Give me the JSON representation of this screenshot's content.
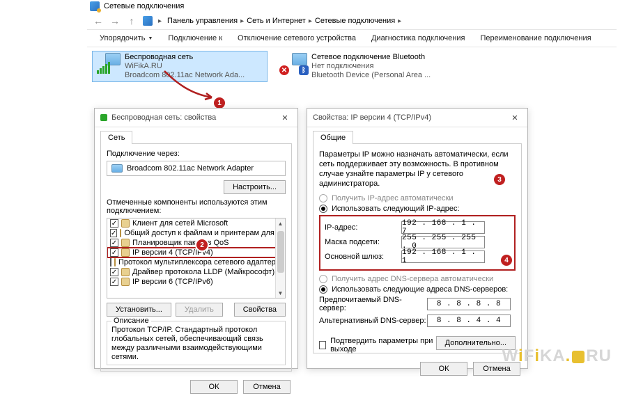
{
  "mainWindow": {
    "title": "Сетевые подключения",
    "breadcrumb": {
      "items": [
        "Панель управления",
        "Сеть и Интернет",
        "Сетевые подключения"
      ]
    },
    "toolbar": {
      "organize": "Упорядочить",
      "connect": "Подключение к",
      "disable": "Отключение сетевого устройства",
      "diagnose": "Диагностика подключения",
      "rename": "Переименование подключения"
    },
    "connections": [
      {
        "line1": "Беспроводная сеть",
        "line2": "WiFikA.RU",
        "line3": "Broadcom 802.11ac Network Ada...",
        "selected": true
      },
      {
        "line1": "Сетевое подключение Bluetooth",
        "line2": "Нет подключения",
        "line3": "Bluetooth Device (Personal Area ..."
      }
    ]
  },
  "dlg1": {
    "title": "Беспроводная сеть: свойства",
    "tab": "Сеть",
    "connVia": "Подключение через:",
    "device": "Broadcom 802.11ac Network Adapter",
    "configure": "Настроить...",
    "componentsLabel": "Отмеченные компоненты используются этим подключением:",
    "components": [
      {
        "checked": true,
        "label": "Клиент для сетей Microsoft"
      },
      {
        "checked": true,
        "label": "Общий доступ к файлам и принтерам для сетей Mi"
      },
      {
        "checked": true,
        "label": "Планировщик пакетов QoS"
      },
      {
        "checked": true,
        "label": "IP версии 4 (TCP/IPv4)",
        "highlight": true
      },
      {
        "checked": false,
        "label": "Протокол мультиплексора сетевого адаптера (Ма"
      },
      {
        "checked": true,
        "label": "Драйвер протокола LLDP (Майкрософт)"
      },
      {
        "checked": true,
        "label": "IP версии 6 (TCP/IPv6)"
      }
    ],
    "install": "Установить...",
    "remove": "Удалить",
    "props": "Свойства",
    "descGroup": "Описание",
    "desc": "Протокол TCP/IP. Стандартный протокол глобальных сетей, обеспечивающий связь между различными взаимодействующими сетями.",
    "ok": "ОК",
    "cancel": "Отмена"
  },
  "dlg2": {
    "title": "Свойства: IP версии 4 (TCP/IPv4)",
    "tab": "Общие",
    "para": "Параметры IP можно назначать автоматически, если сеть поддерживает эту возможность. В противном случае узнайте параметры IP у сетевого администратора.",
    "radioAutoIP": "Получить IP-адрес автоматически",
    "radioManualIP": "Использовать следующий IP-адрес:",
    "ipLabel": "IP-адрес:",
    "ipValue": "192 . 168 .  1  .  7",
    "maskLabel": "Маска подсети:",
    "maskValue": "255 . 255 . 255 .  0",
    "gwLabel": "Основной шлюз:",
    "gwValue": "192 . 168 .  1  .  1",
    "radioAutoDNS": "Получить адрес DNS-сервера автоматически",
    "radioManualDNS": "Использовать следующие адреса DNS-серверов:",
    "dns1Label": "Предпочитаемый DNS-сервер:",
    "dns1Value": "8  .  8  .  8  .  8",
    "dns2Label": "Альтернативный DNS-сервер:",
    "dns2Value": "8  .  8  .  4  .  4",
    "confirmExit": "Подтвердить параметры при выходе",
    "advanced": "Дополнительно...",
    "ok": "ОК",
    "cancel": "Отмена"
  },
  "callouts": {
    "n1": "1",
    "n2": "2",
    "n3": "3",
    "n4": "4"
  },
  "watermark": {
    "p1": "W",
    "p2": "F",
    "p3": "KA",
    "p4": "RU"
  }
}
